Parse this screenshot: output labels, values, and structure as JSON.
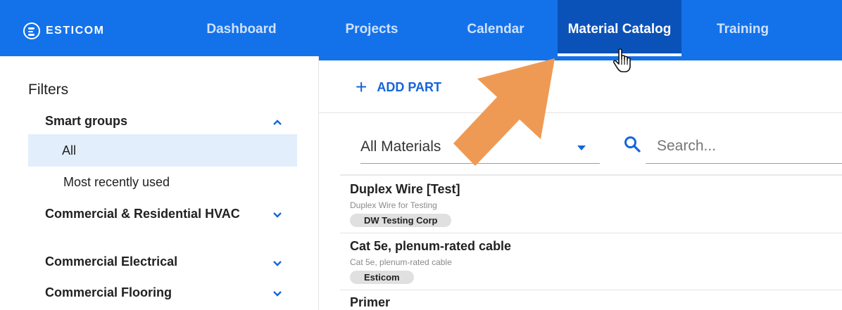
{
  "app": {
    "logo_text": "ESTICOM",
    "brand_color": "#1372ea"
  },
  "nav": {
    "items": [
      {
        "label": "Dashboard"
      },
      {
        "label": "Projects"
      },
      {
        "label": "Calendar"
      },
      {
        "label": "Material Catalog",
        "active": true
      },
      {
        "label": "Training"
      }
    ]
  },
  "sidebar": {
    "title": "Filters",
    "groups": [
      {
        "label": "Smart groups",
        "expanded": true,
        "icon": "chevron-up-icon"
      },
      {
        "label": "Commercial & Residential HVAC",
        "expanded": false,
        "icon": "chevron-down-icon"
      },
      {
        "label": "Commercial Electrical",
        "expanded": false,
        "icon": "chevron-down-icon"
      },
      {
        "label": "Commercial Flooring",
        "expanded": false,
        "icon": "chevron-down-icon"
      }
    ],
    "smart_group_items": [
      {
        "label": "All",
        "selected": true
      },
      {
        "label": "Most recently used",
        "selected": false
      }
    ]
  },
  "main": {
    "add_part_label": "ADD PART",
    "filter_select_value": "All Materials",
    "search_placeholder": "Search...",
    "parts": [
      {
        "name": "Duplex Wire [Test]",
        "description": "Duplex Wire for Testing",
        "vendor": "DW Testing Corp"
      },
      {
        "name": "Cat 5e, plenum-rated cable",
        "description": "Cat 5e, plenum-rated cable",
        "vendor": "Esticom"
      },
      {
        "name": "Primer"
      }
    ]
  },
  "overlay": {
    "arrow_color": "#ee9a54"
  }
}
